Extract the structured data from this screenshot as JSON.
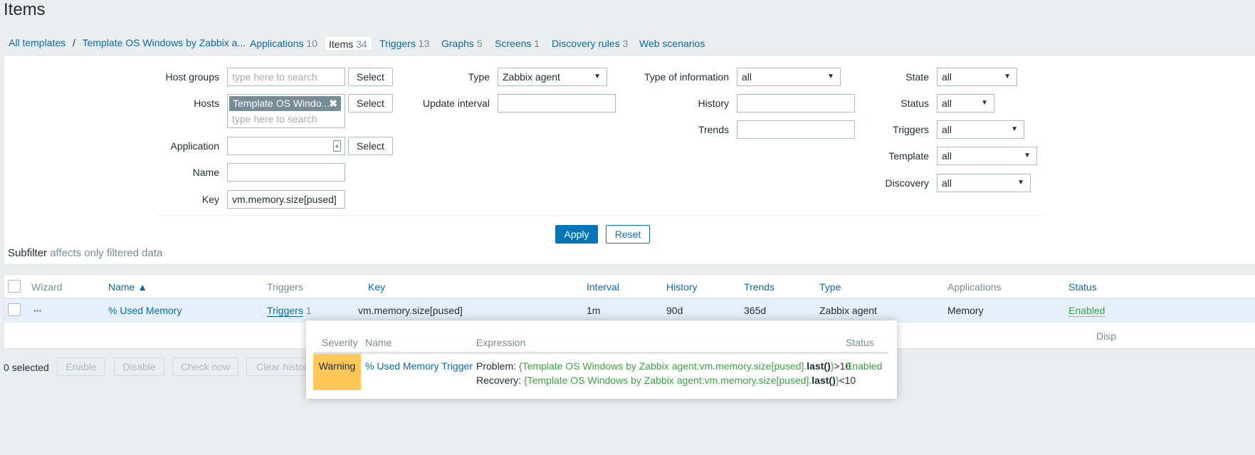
{
  "title": "Items",
  "breadcrumb": {
    "all": "All templates",
    "sep": "/",
    "template": "Template OS Windows by Zabbix a..."
  },
  "tabs": [
    {
      "label": "Applications",
      "count": "10"
    },
    {
      "label": "Items",
      "count": "34"
    },
    {
      "label": "Triggers",
      "count": "13"
    },
    {
      "label": "Graphs",
      "count": "5"
    },
    {
      "label": "Screens",
      "count": "1"
    },
    {
      "label": "Discovery rules",
      "count": "3"
    },
    {
      "label": "Web scenarios",
      "count": ""
    }
  ],
  "filter": {
    "host_groups_label": "Host groups",
    "hosts_label": "Hosts",
    "application_label": "Application",
    "name_label": "Name",
    "key_label": "Key",
    "placeholder": "type here to search",
    "select": "Select",
    "host_chip": "Template OS Windo...",
    "key_value": "vm.memory.size[pused]",
    "type_label": "Type",
    "type_value": "Zabbix agent",
    "update_interval_label": "Update interval",
    "type_info_label": "Type of information",
    "type_info_value": "all",
    "history_label": "History",
    "trends_label": "Trends",
    "state_label": "State",
    "state_value": "all",
    "status_label": "Status",
    "status_value": "all",
    "triggers_label": "Triggers",
    "triggers_value": "all",
    "template_label": "Template",
    "template_value": "all",
    "discovery_label": "Discovery",
    "discovery_value": "all",
    "apply": "Apply",
    "reset": "Reset"
  },
  "subfilter": {
    "title": "Subfilter",
    "note": "affects only filtered data"
  },
  "table": {
    "headers": {
      "wizard": "Wizard",
      "name": "Name ▲",
      "triggers": "Triggers",
      "key": "Key",
      "interval": "Interval",
      "history": "History",
      "trends": "Trends",
      "type": "Type",
      "applications": "Applications",
      "status": "Status"
    },
    "row": {
      "wizard": "•••",
      "name": "% Used Memory",
      "triggers": "Triggers",
      "triggers_count": "1",
      "key": "vm.memory.size[pused]",
      "interval": "1m",
      "history": "90d",
      "trends": "365d",
      "type": "Zabbix agent",
      "applications": "Memory",
      "status": "Enabled"
    },
    "footer": "Disp"
  },
  "actions": {
    "selected": "0 selected",
    "enable": "Enable",
    "disable": "Disable",
    "check_now": "Check now",
    "clear_history": "Clear history"
  },
  "popup": {
    "headers": {
      "severity": "Severity",
      "name": "Name",
      "expression": "Expression",
      "status": "Status"
    },
    "row": {
      "severity": "Warning",
      "name": "% Used Memory Trigger",
      "problem_label": "Problem: ",
      "recovery_label": "Recovery: ",
      "open": "{",
      "expr_item": "Template OS Windows by Zabbix agent:vm.memory.size[pused]",
      "dot": ".",
      "func": "last()",
      "close": "}",
      "problem_cond": ">10",
      "recovery_cond": "<10",
      "status": "Enabled"
    }
  },
  "colors": {
    "link": "#0a6ba6",
    "warning": "#ffc859",
    "enabled": "#429e47",
    "row_highlight": "#e5f0fa"
  }
}
